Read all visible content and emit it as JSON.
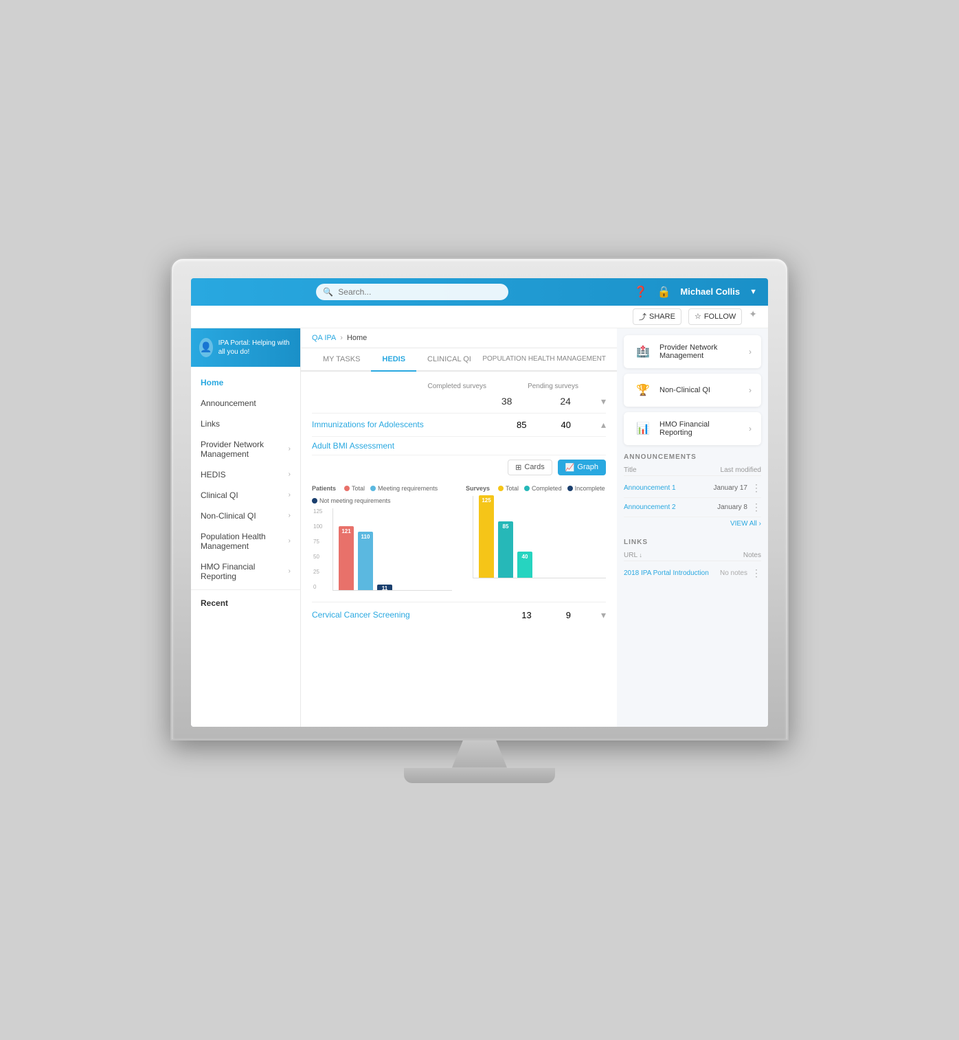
{
  "monitor": {
    "top_bar": {
      "search_placeholder": "Search...",
      "share_label": "SHARE",
      "follow_label": "FOLLOW",
      "user_name": "Michael Collis"
    },
    "sidebar_logo": {
      "text": "IPA Portal: Helping with all you do!"
    },
    "sidebar": {
      "items": [
        {
          "label": "Home",
          "active": true,
          "has_children": false
        },
        {
          "label": "Announcement",
          "has_children": false
        },
        {
          "label": "Links",
          "has_children": false
        },
        {
          "label": "Provider Network Management",
          "has_children": true
        },
        {
          "label": "HEDIS",
          "has_children": true
        },
        {
          "label": "Clinical QI",
          "has_children": true
        },
        {
          "label": "Non-Clinical QI",
          "has_children": true
        },
        {
          "label": "Population Health Management",
          "has_children": true
        },
        {
          "label": "HMO Financial Reporting",
          "has_children": true
        }
      ],
      "recent_label": "Recent"
    },
    "breadcrumb": {
      "items": [
        "QA IPA",
        "Home"
      ]
    },
    "tabs": [
      {
        "label": "MY TASKS"
      },
      {
        "label": "HEDIS",
        "active": true
      },
      {
        "label": "CLINICAL QI"
      }
    ],
    "phm_tab": "POPULATION HEALTH MANAGEMENT",
    "surveys": {
      "headers": {
        "completed": "Completed surveys",
        "pending": "Pending surveys"
      },
      "rows": [
        {
          "name": "Immunizations for Adolescents",
          "completed": 85,
          "pending": 40,
          "expanded": true
        },
        {
          "name": "Adult BMI Assessment",
          "completed": "",
          "pending": ""
        },
        {
          "name": "Cervical Cancer Screening",
          "completed": 13,
          "pending": 9
        }
      ],
      "first_row": {
        "completed": 38,
        "pending": 24
      }
    },
    "view_toggle": {
      "cards_label": "Cards",
      "graph_label": "Graph"
    },
    "chart": {
      "patients_label": "Patients",
      "surveys_label": "Surveys",
      "patients_legend": [
        {
          "label": "Total",
          "color": "#e05a5a"
        },
        {
          "label": "Meeting requirements",
          "color": "#5bb8e0"
        },
        {
          "label": "Not meeting requirements",
          "color": "#1a3f6e"
        }
      ],
      "surveys_legend": [
        {
          "label": "Total",
          "color": "#f5c518"
        },
        {
          "label": "Completed",
          "color": "#26b8b8"
        },
        {
          "label": "Incomplete",
          "color": "#1a3f6e"
        }
      ],
      "patients_bars": [
        {
          "value": 121,
          "color": "#e8716a"
        },
        {
          "value": 110,
          "color": "#5bb8e0"
        },
        {
          "value": 11,
          "color": "#1a3f6e"
        }
      ],
      "surveys_bars": [
        {
          "value": 125,
          "color": "#f5c518"
        },
        {
          "value": 85,
          "color": "#26b8b8"
        },
        {
          "value": 40,
          "color": "#26d4c0"
        }
      ],
      "y_axis": [
        "125",
        "100",
        "75",
        "50",
        "25",
        "0"
      ]
    },
    "right_panel": {
      "quick_links": [
        {
          "label": "Provider Network Management",
          "icon": "🏥"
        },
        {
          "label": "Non-Clinical QI",
          "icon": "🏆"
        },
        {
          "label": "HMO Financial Reporting",
          "icon": "📊"
        }
      ],
      "announcements": {
        "title": "ANNOUNCEMENTS",
        "headers": {
          "title": "Title",
          "last_modified": "Last modified"
        },
        "rows": [
          {
            "title": "Announcement 1",
            "date": "January 17"
          },
          {
            "title": "Announcement 2",
            "date": "January 8"
          }
        ],
        "view_all": "VIEW All"
      },
      "links": {
        "title": "LINKS",
        "headers": {
          "url": "URL",
          "notes": "Notes"
        },
        "rows": [
          {
            "title": "2018 IPA Portal Introduction",
            "notes": "No notes"
          }
        ]
      }
    }
  }
}
